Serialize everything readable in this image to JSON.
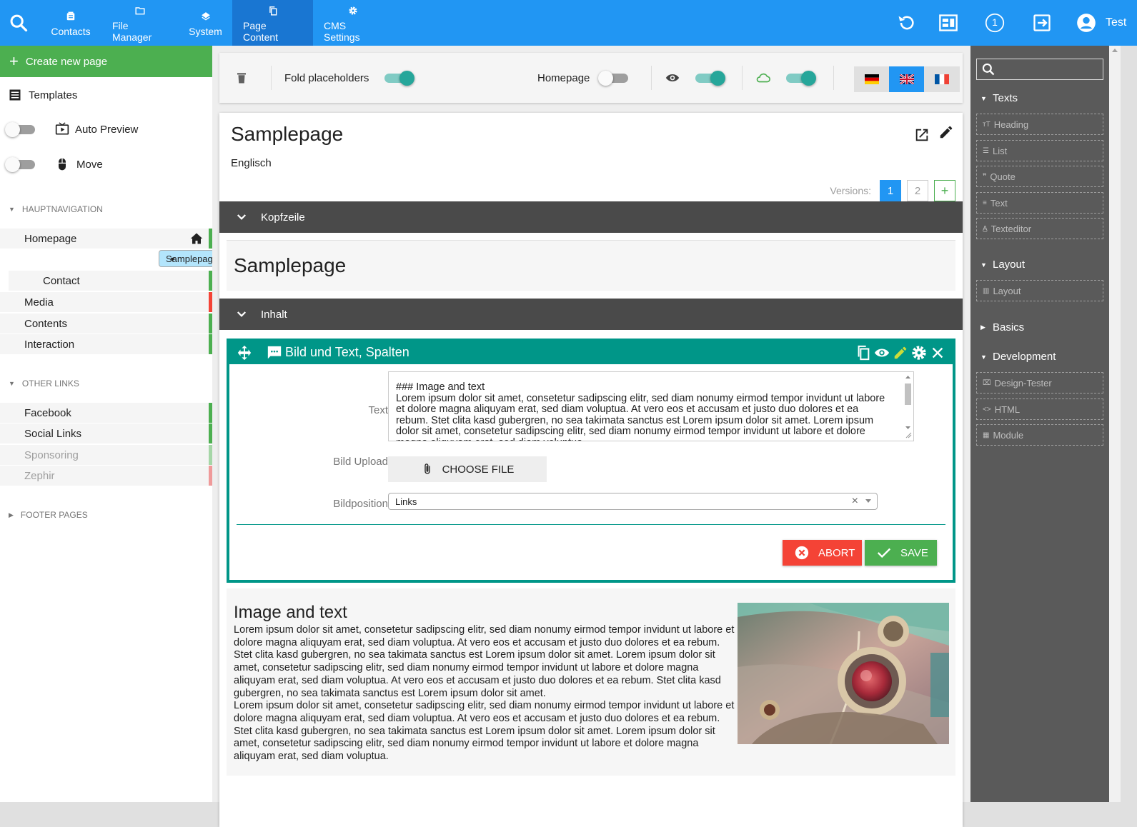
{
  "topbar": {
    "nav": [
      {
        "label": "Contacts",
        "icon": "contacts-icon"
      },
      {
        "label": "File Manager",
        "icon": "folder-icon"
      },
      {
        "label": "System",
        "icon": "layers-icon"
      },
      {
        "label": "Page Content",
        "icon": "copy-icon"
      },
      {
        "label": "CMS Settings",
        "icon": "gear-icon"
      }
    ],
    "active_nav": "Page Content",
    "notification_count": "1",
    "user_name": "Test",
    "color": "#2196f3"
  },
  "sidebar": {
    "create_label": "Create new page",
    "templates_label": "Templates",
    "auto_preview_label": "Auto Preview",
    "move_label": "Move",
    "sections": [
      {
        "title": "HAUPTNAVIGATION",
        "items": [
          {
            "label": "Homepage",
            "status": "green",
            "home": true
          },
          {
            "label": "Samplepage",
            "status": "green",
            "selected": true
          },
          {
            "label": "Contact",
            "status": "green",
            "child": true
          },
          {
            "label": "Media",
            "status": "red"
          },
          {
            "label": "Contents",
            "status": "green"
          },
          {
            "label": "Interaction",
            "status": "green"
          }
        ]
      },
      {
        "title": "OTHER LINKS",
        "items": [
          {
            "label": "Facebook",
            "status": "green"
          },
          {
            "label": "Social Links",
            "status": "green"
          },
          {
            "label": "Sponsoring",
            "status": "green",
            "disabled": true
          },
          {
            "label": "Zephir",
            "status": "red",
            "disabled": true
          }
        ]
      },
      {
        "title": "FOOTER PAGES",
        "collapsed": true
      }
    ]
  },
  "toolbar": {
    "fold_label": "Fold placeholders",
    "fold_on": true,
    "homepage_label": "Homepage",
    "homepage_on": false,
    "visible_on": true,
    "cloud_on": true,
    "languages": [
      "de",
      "en",
      "fr"
    ],
    "active_language": "en"
  },
  "page": {
    "title": "Samplepage",
    "language": "Englisch",
    "versions_label": "Versions:",
    "versions": [
      "1",
      "2"
    ],
    "active_version": "1",
    "add_version": "+"
  },
  "sections": {
    "header_band": "Kopfzeile",
    "header_content": "Samplepage",
    "content_band": "Inhalt"
  },
  "editor": {
    "title": "Bild und Text, Spalten",
    "text_label": "Text",
    "text_value_heading": "### Image and text",
    "text_value_body": "Lorem ipsum dolor sit amet, consetetur sadipscing elitr, sed diam nonumy eirmod tempor invidunt ut labore et dolore magna aliquyam erat, sed diam voluptua. At vero eos et accusam et justo duo dolores et ea rebum. Stet clita kasd gubergren, no sea takimata sanctus est Lorem ipsum dolor sit amet. Lorem ipsum dolor sit amet, consetetur sadipscing elitr, sed diam nonumy eirmod tempor invidunt ut labore et dolore magna aliquyam erat, sed diam voluptua.",
    "upload_label": "Bild Upload",
    "choose_file": "CHOOSE FILE",
    "position_label": "Bildposition",
    "position_value": "Links",
    "abort": "ABORT",
    "save": "SAVE"
  },
  "preview": {
    "heading": "Image and text",
    "paragraph1": "Lorem ipsum dolor sit amet, consetetur sadipscing elitr, sed diam nonumy eirmod tempor invidunt ut labore et dolore magna aliquyam erat, sed diam voluptua. At vero eos et accusam et justo duo dolores et ea rebum. Stet clita kasd gubergren, no sea takimata sanctus est Lorem ipsum dolor sit amet. Lorem ipsum dolor sit amet, consetetur sadipscing elitr, sed diam nonumy eirmod tempor invidunt ut labore et dolore magna aliquyam erat, sed diam voluptua. At vero eos et accusam et justo duo dolores et ea rebum. Stet clita kasd gubergren, no sea takimata sanctus est Lorem ipsum dolor sit amet.",
    "paragraph2": "Lorem ipsum dolor sit amet, consetetur sadipscing elitr, sed diam nonumy eirmod tempor invidunt ut labore et dolore magna aliquyam erat, sed diam voluptua. At vero eos et accusam et justo duo dolores et ea rebum. Stet clita kasd gubergren, no sea takimata sanctus est Lorem ipsum dolor sit amet. Lorem ipsum dolor sit amet, consetetur sadipscing elitr, sed diam nonumy eirmod tempor invidunt ut labore et dolore magna aliquyam erat, sed diam voluptua.",
    "image": "vintage-car-image"
  },
  "rpanel": {
    "groups": [
      {
        "title": "Texts",
        "expanded": true,
        "items": [
          "Heading",
          "List",
          "Quote",
          "Text",
          "Texteditor"
        ]
      },
      {
        "title": "Layout",
        "expanded": true,
        "items": [
          "Layout"
        ]
      },
      {
        "title": "Basics",
        "expanded": false,
        "items": []
      },
      {
        "title": "Development",
        "expanded": true,
        "items": [
          "Design-Tester",
          "HTML",
          "Module"
        ]
      }
    ]
  }
}
